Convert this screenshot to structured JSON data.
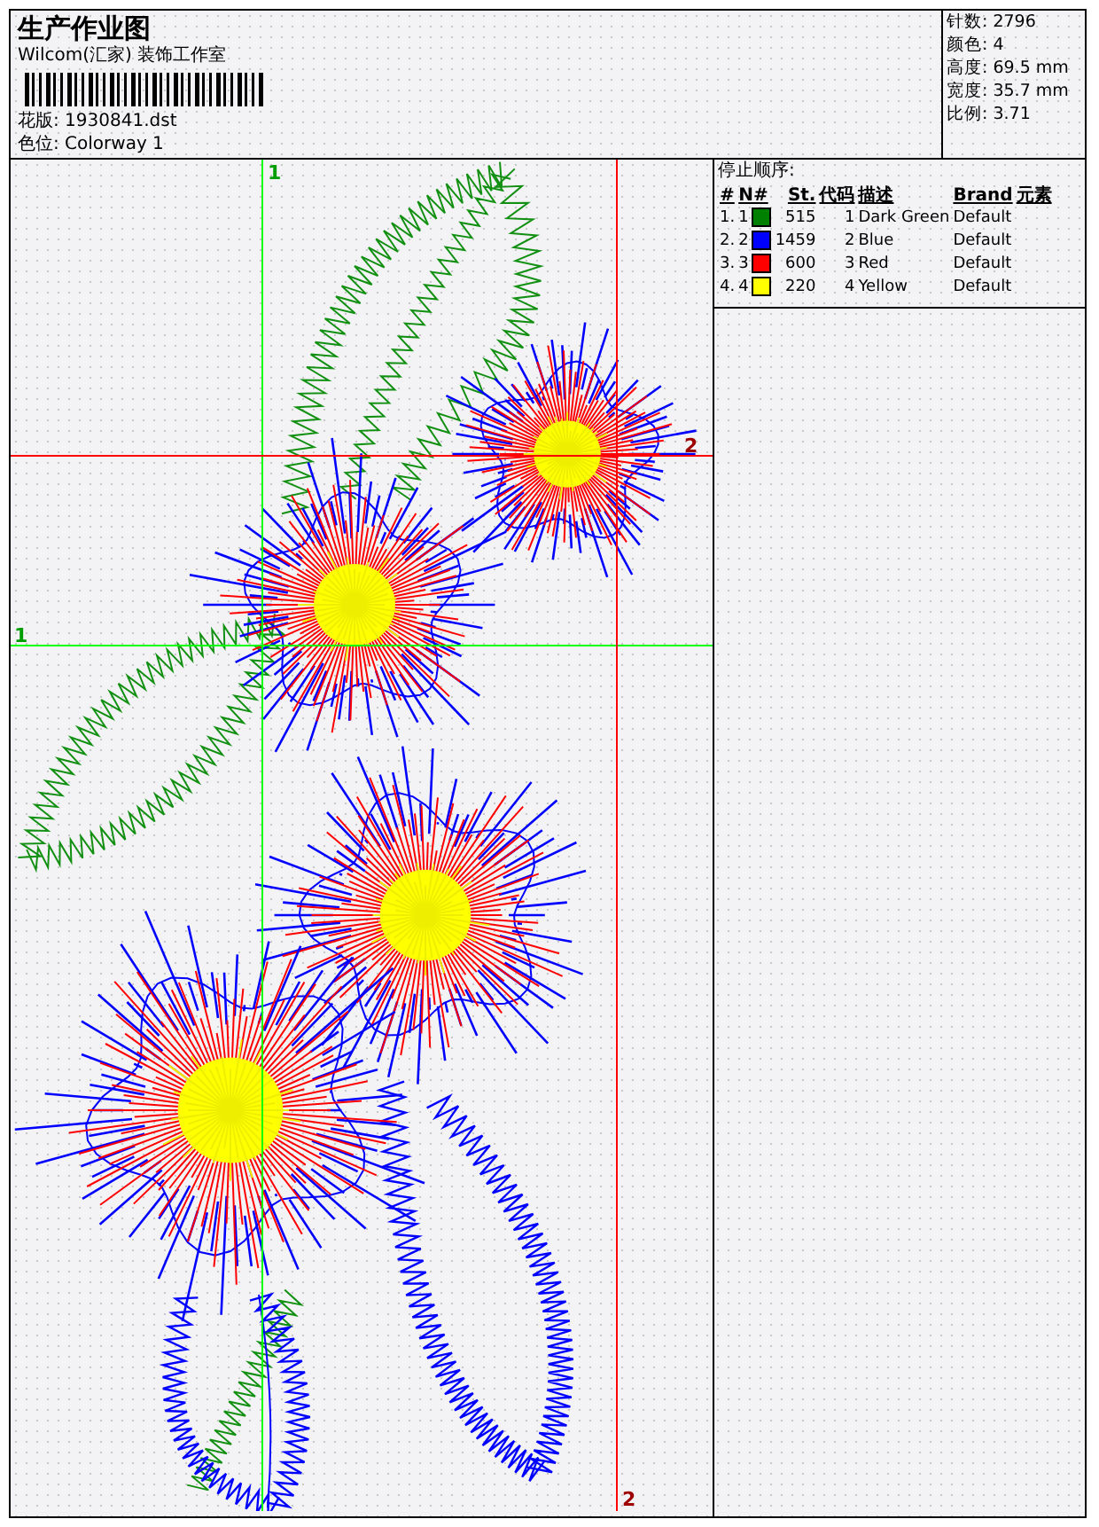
{
  "header": {
    "title": "生产作业图",
    "company": "Wilcom(汇家) 装饰工作室",
    "design_file": "花版: 1930841.dst",
    "colorway": "色位: Colorway 1"
  },
  "info": [
    "针数: 2796",
    "颜色: 4",
    "高度: 69.5 mm",
    "宽度: 35.7 mm",
    "比例: 3.71"
  ],
  "guides": [
    {
      "label": "1",
      "kind": "vertical",
      "color": "#00ff00"
    },
    {
      "label": "1",
      "kind": "horizontal",
      "color": "#00ff00"
    },
    {
      "label": "2",
      "kind": "horizontal",
      "color": "#ff0000"
    },
    {
      "label": "2",
      "kind": "vertical",
      "color": "#ff0000"
    }
  ],
  "stop_sequence": {
    "title": "停止顺序:",
    "columns": [
      "#",
      "N#",
      "St.",
      "代码",
      "描述",
      "Brand",
      "元素"
    ],
    "rows": [
      {
        "index": "1.",
        "number": "1",
        "color": "#008000",
        "stitches": "515",
        "code": "1",
        "description": "Dark Green",
        "brand": "Default"
      },
      {
        "index": "2.",
        "number": "2",
        "color": "#0000ff",
        "stitches": "1459",
        "code": "2",
        "description": "Blue",
        "brand": "Default"
      },
      {
        "index": "3.",
        "number": "3",
        "color": "#ff0000",
        "stitches": "600",
        "code": "3",
        "description": "Red",
        "brand": "Default"
      },
      {
        "index": "4.",
        "number": "4",
        "color": "#ffff00",
        "stitches": "220",
        "code": "4",
        "description": "Yellow",
        "brand": "Default"
      }
    ]
  }
}
